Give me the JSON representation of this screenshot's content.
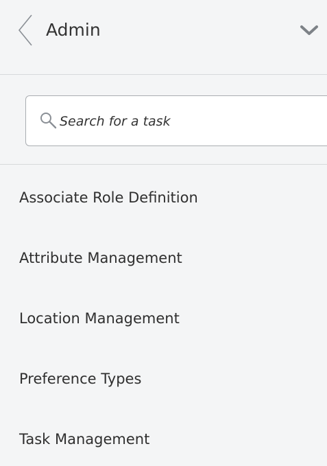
{
  "header": {
    "title": "Admin",
    "back_icon": "chevron-left-icon",
    "collapse_icon": "chevron-down-icon"
  },
  "search": {
    "placeholder": "Search for a task",
    "value": "",
    "icon": "search-icon"
  },
  "tasks": [
    {
      "label": "Associate Role Definition"
    },
    {
      "label": "Attribute Management"
    },
    {
      "label": "Location Management"
    },
    {
      "label": "Preference Types"
    },
    {
      "label": "Task Management"
    }
  ],
  "colors": {
    "background": "#f4f5f6",
    "text": "#2f2f2f",
    "divider": "#d7d9db",
    "input_border": "#a9adb1",
    "icon": "#8a8f95"
  }
}
